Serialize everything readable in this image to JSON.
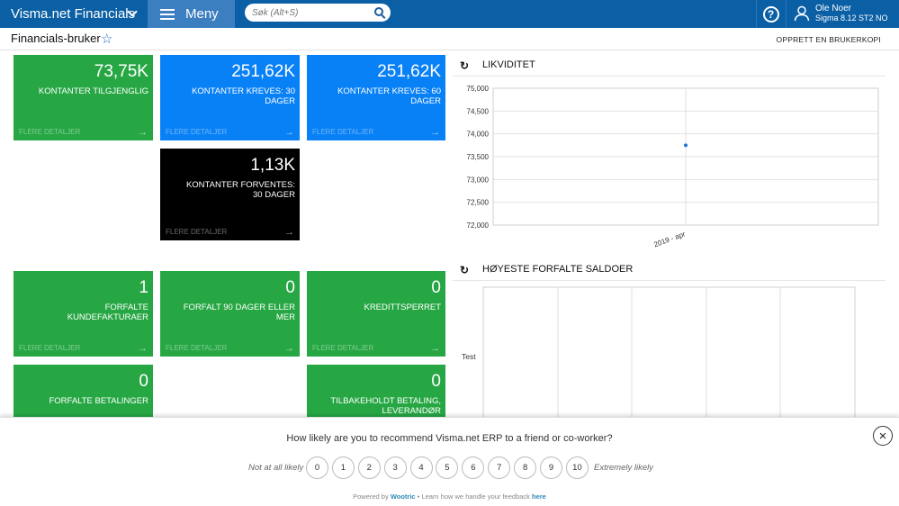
{
  "topbar": {
    "app_name": "Visma.net Financials",
    "menu_label": "Meny",
    "search_placeholder": "Søk (Alt+S)",
    "help_label": "?",
    "user_name": "Ole Noer",
    "user_company": "Sigma 8.12 ST2 NO"
  },
  "header": {
    "page_title": "Financials-bruker",
    "create_copy": "OPPRETT EN BRUKERKOPI"
  },
  "tiles": [
    {
      "value": "73,75K",
      "label": "KONTANTER TILGJENGLIG",
      "more": "FLERE DETALJER",
      "color": "green"
    },
    {
      "value": "251,62K",
      "label": "KONTANTER KREVES: 30 DAGER",
      "more": "FLERE DETALJER",
      "color": "blue"
    },
    {
      "value": "251,62K",
      "label": "KONTANTER KREVES: 60 DAGER",
      "more": "FLERE DETALJER",
      "color": "blue"
    },
    {
      "value": "1,13K",
      "label": "KONTANTER FORVENTES: 30 DAGER",
      "more": "FLERE DETALJER",
      "color": "black"
    },
    {
      "value": "1",
      "label": "FORFALTE KUNDEFAKTURAER",
      "more": "FLERE DETALJER",
      "color": "green"
    },
    {
      "value": "0",
      "label": "FORFALT 90 DAGER ELLER MER",
      "more": "FLERE DETALJER",
      "color": "green"
    },
    {
      "value": "0",
      "label": "KREDITTSPERRET",
      "more": "FLERE DETALJER",
      "color": "green"
    },
    {
      "value": "0",
      "label": "FORFALTE BETALINGER",
      "more": "",
      "color": "green"
    },
    {
      "value": "0",
      "label": "TILBAKEHOLDT BETALING, LEVERANDØR",
      "more": "",
      "color": "green"
    }
  ],
  "widgets": {
    "liquidity_title": "LIKVIDITET",
    "balances_title": "HØYESTE FORFALTE SALDOER",
    "balances_row_label": "Test"
  },
  "chart_data": {
    "type": "scatter",
    "title": "LIKVIDITET",
    "x": [
      "2019 - apr"
    ],
    "y": [
      73750
    ],
    "ylim": [
      72000,
      75000
    ],
    "yticks": [
      "72,000",
      "72,500",
      "73,000",
      "73,500",
      "74,000",
      "74,500",
      "75,000"
    ],
    "point_color": "#1a73d9",
    "grid": true
  },
  "survey": {
    "question": "How likely are you to recommend Visma.net ERP to a friend or co-worker?",
    "low_label": "Not at all likely",
    "high_label": "Extremely likely",
    "scale": [
      "0",
      "1",
      "2",
      "3",
      "4",
      "5",
      "6",
      "7",
      "8",
      "9",
      "10"
    ],
    "powered_prefix": "Powered by",
    "powered_brand": "Wootric",
    "powered_middle": "• Learn how we handle your feedback",
    "powered_link": "here",
    "close_label": "×"
  }
}
